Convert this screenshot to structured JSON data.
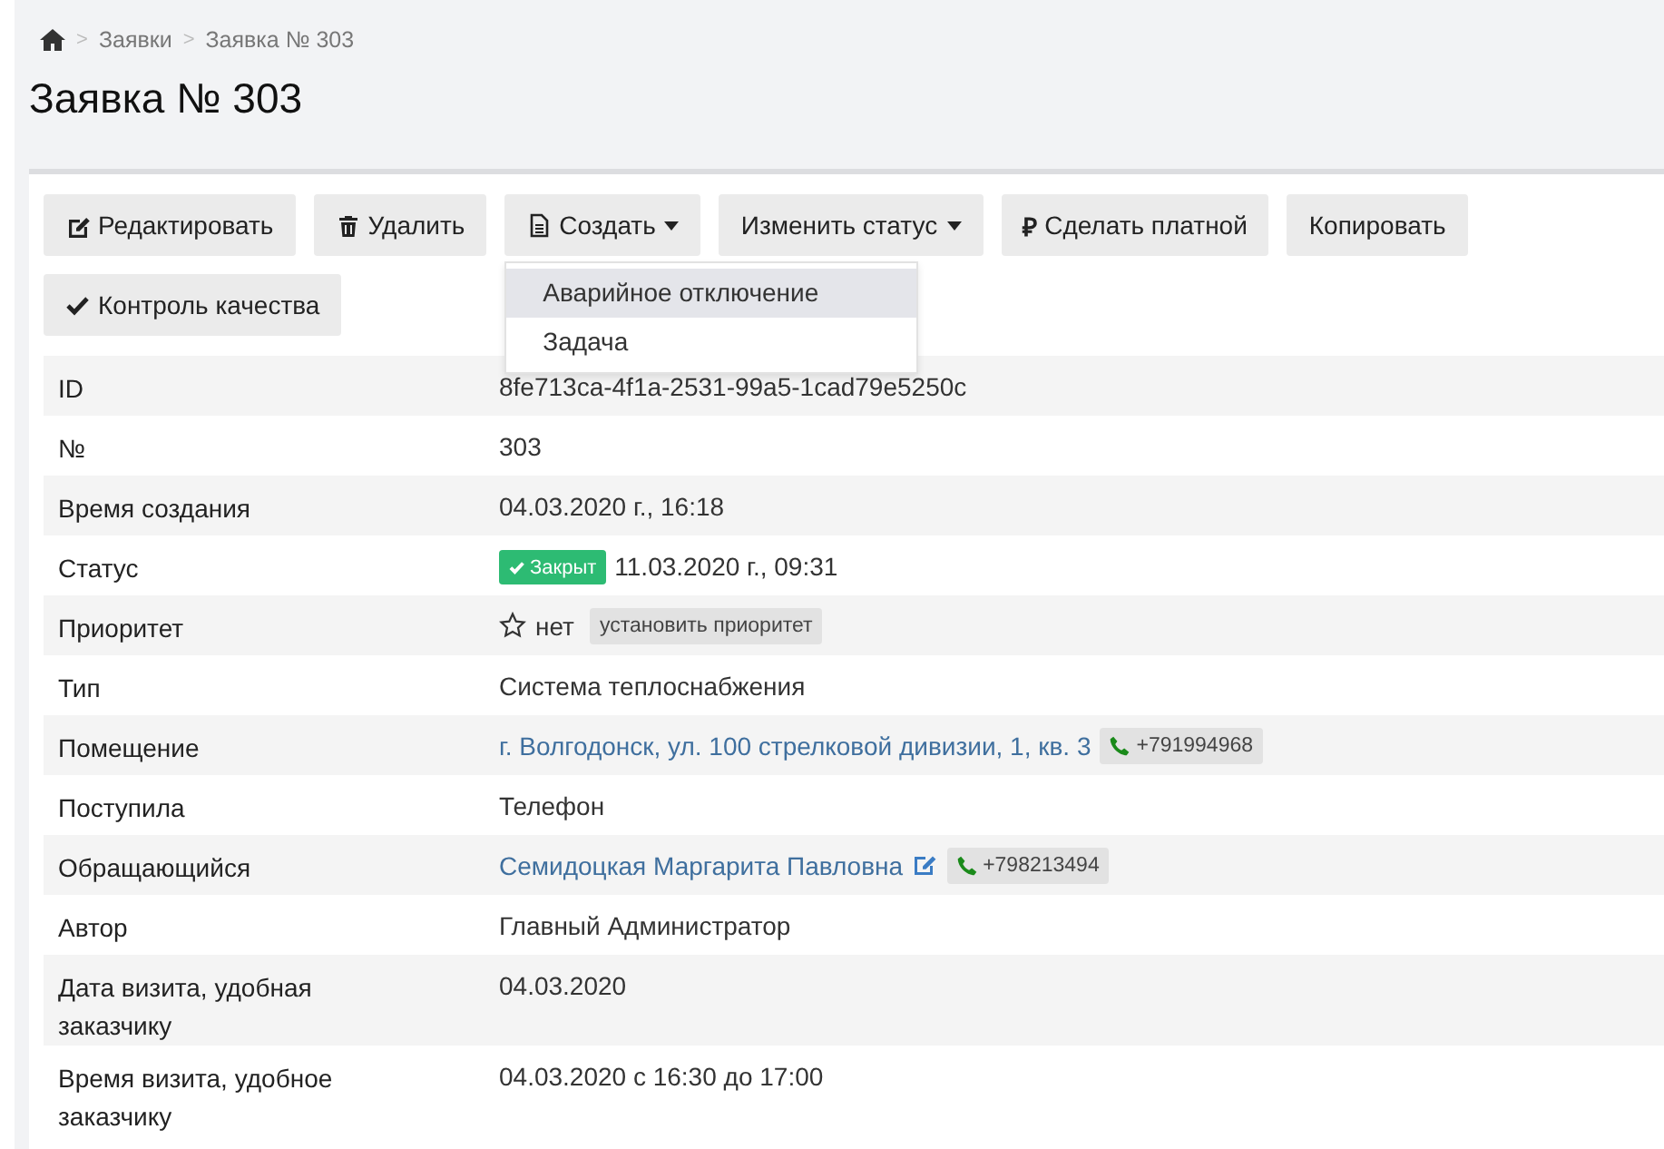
{
  "breadcrumb": {
    "items": [
      {
        "separator": ">",
        "label": "Заявки"
      },
      {
        "separator": ">",
        "label": "Заявка № 303"
      }
    ]
  },
  "title": "Заявка № 303",
  "toolbar": [
    {
      "label": "Редактировать",
      "caret": false
    },
    {
      "label": "Удалить",
      "caret": false
    },
    {
      "label": "Создать",
      "caret": true
    },
    {
      "label": "Изменить статус",
      "caret": true
    },
    {
      "label": "Сделать платной",
      "glyph": "₽",
      "caret": false
    },
    {
      "label": "Копировать",
      "caret": false
    },
    {
      "label": "Контроль качества",
      "caret": false
    }
  ],
  "dropdown": {
    "items": [
      {
        "label": "Аварийное отключение",
        "selected": true
      },
      {
        "label": "Задача",
        "selected": false
      }
    ]
  },
  "rows": [
    {
      "label": "ID",
      "kind": "text",
      "value": "8fe713ca-4f1a-2531-99a5-1cad79e5250c"
    },
    {
      "label": "№",
      "kind": "text",
      "value": "303"
    },
    {
      "label": "Время создания",
      "kind": "text",
      "value": "04.03.2020 г., 16:18"
    },
    {
      "label": "Статус",
      "kind": "status",
      "badge": "Закрыт",
      "color": "#2dbb73",
      "value": "11.03.2020 г., 09:31"
    },
    {
      "label": "Приоритет",
      "kind": "priority",
      "value": "нет",
      "action": "установить приоритет"
    },
    {
      "label": "Тип",
      "kind": "text",
      "value": "Система теплоснабжения"
    },
    {
      "label": "Помещение",
      "kind": "link",
      "value": "г. Волгодонск, ул. 100 стрелковой дивизии, 1, кв. 3",
      "phone": "+791994968"
    },
    {
      "label": "Поступила",
      "kind": "text",
      "value": "Телефон"
    },
    {
      "label": "Обращающийся",
      "kind": "contact",
      "value": "Семидоцкая Маргарита Павловна",
      "phone": "+798213494"
    },
    {
      "label": "Автор",
      "kind": "text",
      "value": "Главный Администратор"
    },
    {
      "label": "Дата визита, удобная заказчику",
      "kind": "text",
      "value": "04.03.2020"
    },
    {
      "label": "Время визита, удобное заказчику",
      "kind": "text",
      "value": "04.03.2020 с 16:30 до 17:00"
    }
  ]
}
